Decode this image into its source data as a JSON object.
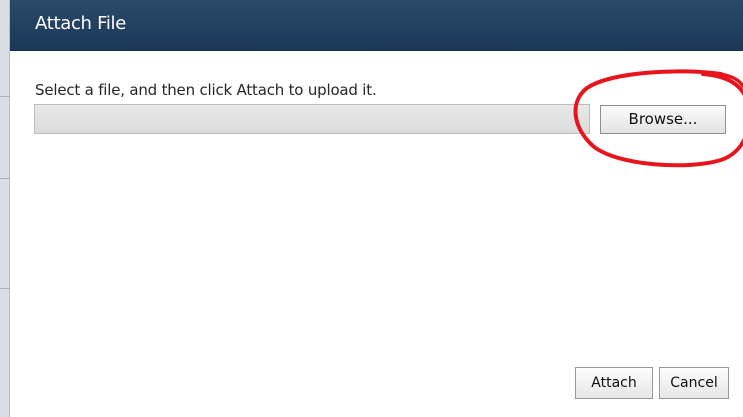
{
  "dialog": {
    "title": "Attach File",
    "instructions": "Select a file, and then click Attach to upload it.",
    "file_input": {
      "value": "",
      "placeholder": ""
    },
    "browse_label": "Browse...",
    "attach_label": "Attach",
    "cancel_label": "Cancel"
  },
  "annotation": {
    "highlight_color": "#e8141c",
    "target": "browse-button"
  },
  "colors": {
    "titlebar": "#1f3e5d",
    "title_text": "#ffffff",
    "input_fill": "#e2e2e2"
  }
}
